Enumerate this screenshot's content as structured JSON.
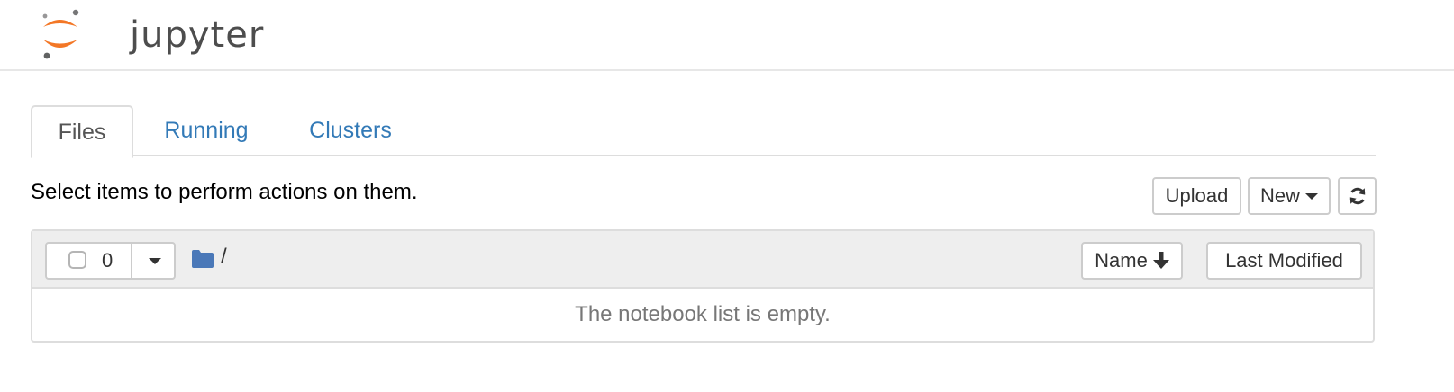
{
  "header": {
    "logo_text": "jupyter"
  },
  "tabs": [
    {
      "label": "Files",
      "active": true
    },
    {
      "label": "Running",
      "active": false
    },
    {
      "label": "Clusters",
      "active": false
    }
  ],
  "toolbar": {
    "hint": "Select items to perform actions on them.",
    "upload_label": "Upload",
    "new_label": "New",
    "refresh_icon": "refresh-icon"
  },
  "list": {
    "selected_count": "0",
    "path": "/",
    "folder_icon": "folder-icon",
    "sort_name_label": "Name",
    "sort_modified_label": "Last Modified",
    "empty_message": "The notebook list is empty."
  },
  "colors": {
    "brand_orange": "#f37726",
    "link": "#337ab7",
    "folder": "#4a78b8"
  }
}
